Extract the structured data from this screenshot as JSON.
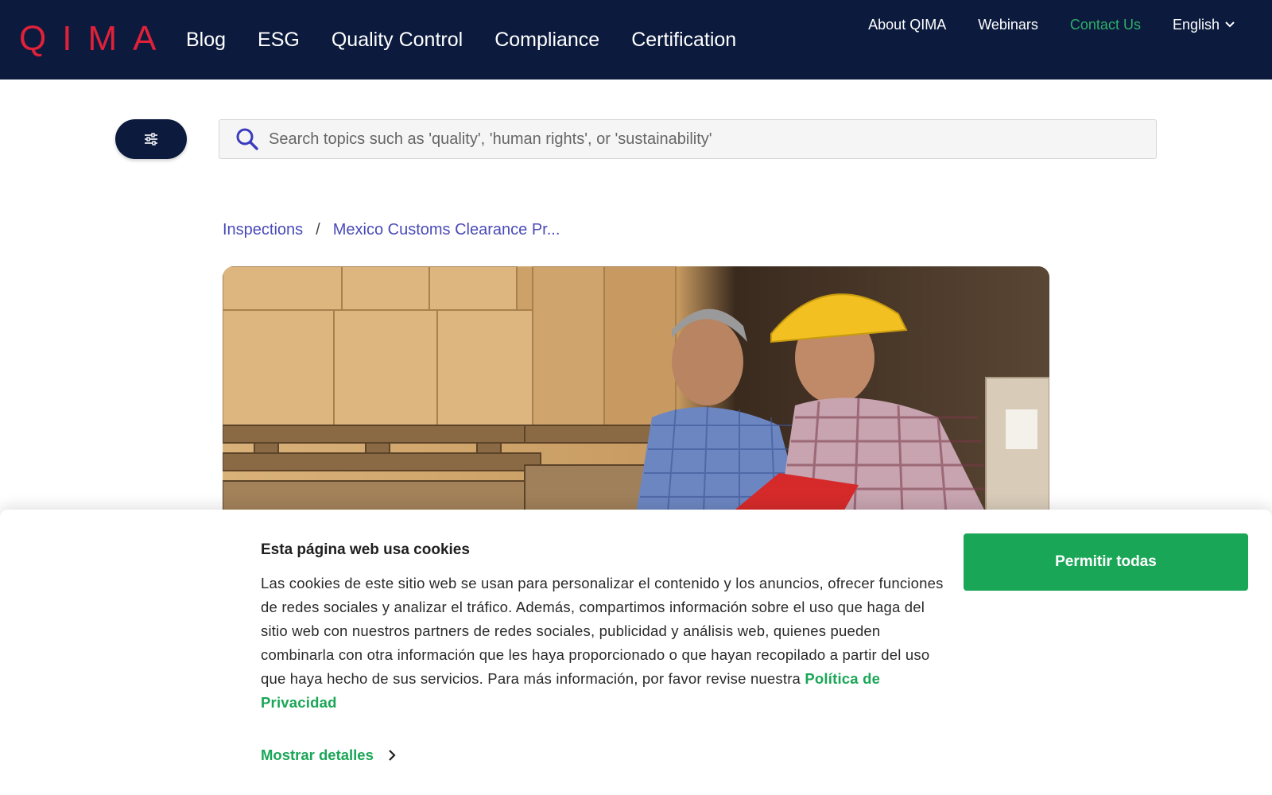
{
  "header": {
    "logo": "QIMA",
    "nav": [
      "Blog",
      "ESG",
      "Quality Control",
      "Compliance",
      "Certification"
    ],
    "utility": {
      "about": "About QIMA",
      "webinars": "Webinars",
      "contact": "Contact Us",
      "language": "English"
    }
  },
  "search": {
    "placeholder": "Search topics such as 'quality', 'human rights', or 'sustainability'"
  },
  "breadcrumb": {
    "parent": "Inspections",
    "separator": "/",
    "current": "Mexico Customs Clearance Pr..."
  },
  "cookie": {
    "title": "Esta página web usa cookies",
    "body": "Las cookies de este sitio web se usan para personalizar el contenido y los anuncios, ofrecer funciones de redes sociales y analizar el tráfico. Además, compartimos información sobre el uso que haga del sitio web con nuestros partners de redes sociales, publicidad y análisis web, quienes pueden combinarla con otra información que les haya proporcionado o que hayan recopilado a partir del uso que haya hecho de sus servicios. Para más información, por favor revise nuestra",
    "policy_link": "Política de Privacidad",
    "details_label": "Mostrar detalles",
    "allow_label": "Permitir todas"
  },
  "colors": {
    "header_bg": "#0b1a3d",
    "brand_red": "#e0213a",
    "accent_green": "#1aa657",
    "link_blue": "#4a4ab8"
  },
  "icons": {
    "filter": "sliders-icon",
    "search": "search-icon",
    "language": "chevron-down-icon",
    "details": "chevron-right-icon"
  }
}
